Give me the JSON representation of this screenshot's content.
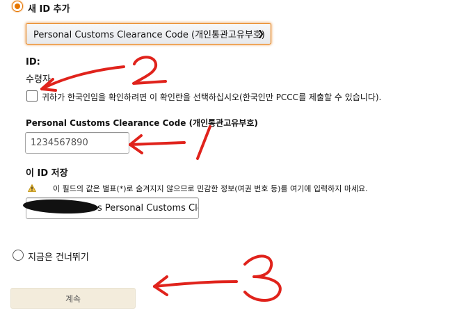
{
  "new_id_option": {
    "label": "새 ID 추가",
    "selected": true
  },
  "id_type_select": {
    "selected_value": "Personal Customs Clearance Code (개인통관고유부호)"
  },
  "id_section": {
    "title": "ID:",
    "recipient_label": "수령자"
  },
  "confirmation_checkbox": {
    "label": "귀하가 한국인임을 확인하려면 이 확인란을 선택하십시오(한국인만 PCCC를 제출할 수 있습니다).",
    "checked": false
  },
  "code_field": {
    "label": "Personal Customs Clearance Code (개인통관고유부호)",
    "value": "1234567890"
  },
  "save_id": {
    "label": "이 ID 저장",
    "warning": "이 필드의 값은 별표(*)로 숨겨지지 않으므로 민감한 정보(여권 번호 등)를 여기에 입력하지 마세요.",
    "value_visible": "s Personal Customs Clea"
  },
  "skip_option": {
    "label": "지금은 건너뛰기",
    "selected": false
  },
  "continue_button": {
    "label": "계속"
  },
  "annotations": {
    "num1": "1",
    "num2": "2",
    "num3": "3",
    "color": "#e0231c"
  },
  "colors": {
    "accent": "#e77600",
    "button_bg": "#f3ecdc",
    "warning": "#f0c14b"
  }
}
